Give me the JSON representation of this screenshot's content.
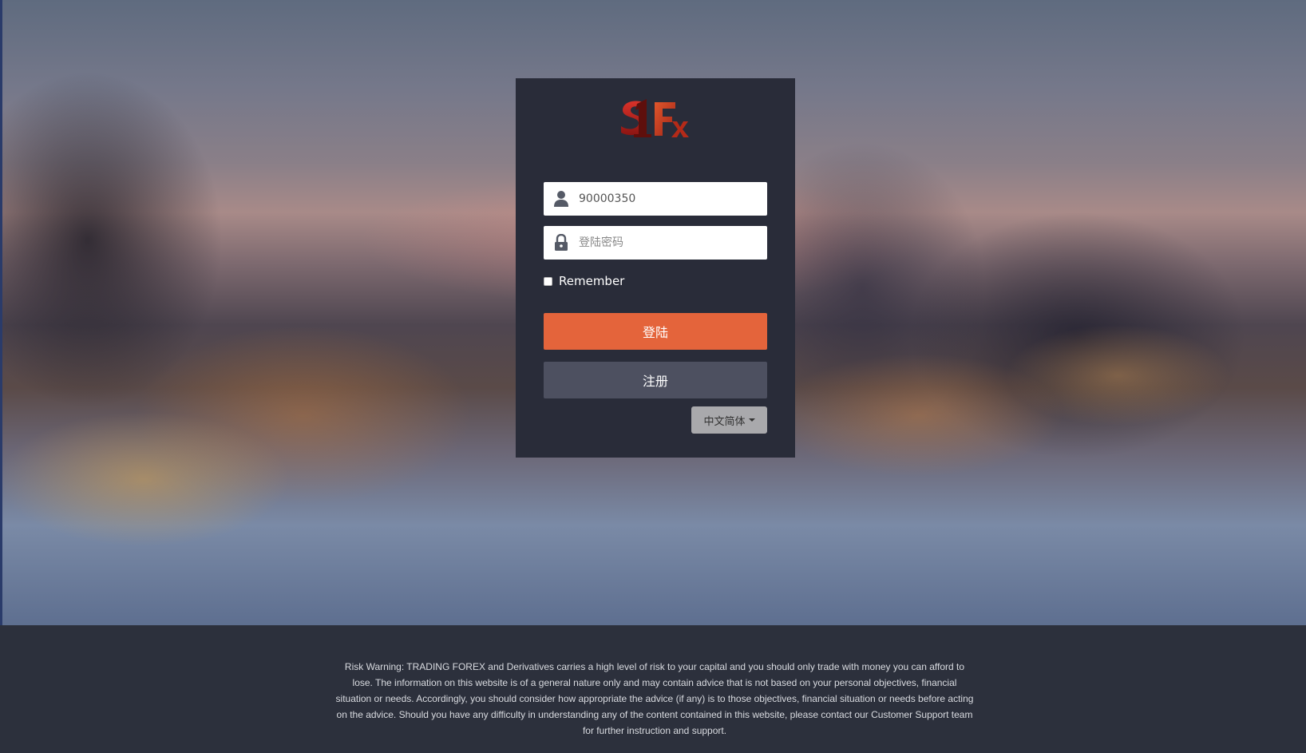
{
  "logo": {
    "text": "1Fx"
  },
  "login_form": {
    "username": {
      "value": "90000350",
      "placeholder": ""
    },
    "password": {
      "value": "",
      "placeholder": "登陆密码"
    },
    "remember_label": "Remember",
    "login_button": "登陆",
    "register_button": "注册",
    "language_selector": "中文简体"
  },
  "footer": {
    "risk_warning": "Risk Warning: TRADING FOREX and Derivatives carries a high level of risk to your capital and you should only trade with money you can afford to lose. The information on this website is of a general nature only and may contain advice that is not based on your personal objectives, financial situation or needs. Accordingly, you should consider how appropriate the advice (if any) is to those objectives, financial situation or needs before acting on the advice. Should you have any difficulty in understanding any of the content contained in this website, please contact our Customer Support team for further instruction and support."
  },
  "colors": {
    "card_bg": "#292c39",
    "login_button": "#e4643b",
    "register_button": "#4d5060",
    "footer_bg": "#2c303c"
  },
  "icons": [
    "user-icon",
    "lock-icon",
    "chevron-down-icon"
  ]
}
